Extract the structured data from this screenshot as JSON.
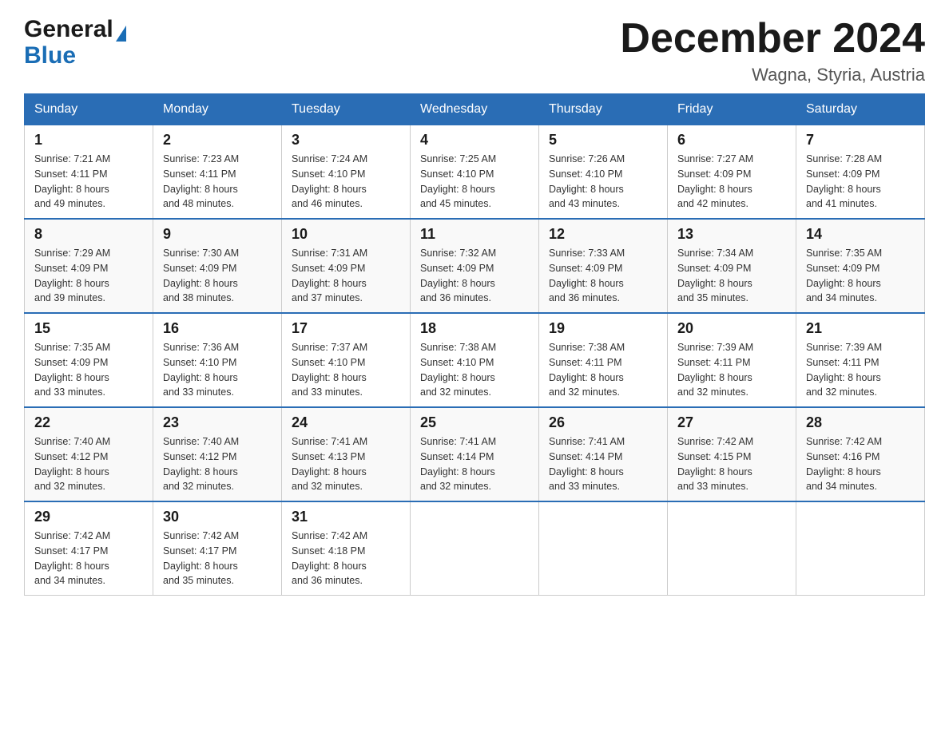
{
  "logo": {
    "general": "General",
    "blue": "Blue"
  },
  "title": "December 2024",
  "subtitle": "Wagna, Styria, Austria",
  "days_of_week": [
    "Sunday",
    "Monday",
    "Tuesday",
    "Wednesday",
    "Thursday",
    "Friday",
    "Saturday"
  ],
  "weeks": [
    [
      {
        "day": "1",
        "sunrise": "7:21 AM",
        "sunset": "4:11 PM",
        "daylight": "8 hours and 49 minutes."
      },
      {
        "day": "2",
        "sunrise": "7:23 AM",
        "sunset": "4:11 PM",
        "daylight": "8 hours and 48 minutes."
      },
      {
        "day": "3",
        "sunrise": "7:24 AM",
        "sunset": "4:10 PM",
        "daylight": "8 hours and 46 minutes."
      },
      {
        "day": "4",
        "sunrise": "7:25 AM",
        "sunset": "4:10 PM",
        "daylight": "8 hours and 45 minutes."
      },
      {
        "day": "5",
        "sunrise": "7:26 AM",
        "sunset": "4:10 PM",
        "daylight": "8 hours and 43 minutes."
      },
      {
        "day": "6",
        "sunrise": "7:27 AM",
        "sunset": "4:09 PM",
        "daylight": "8 hours and 42 minutes."
      },
      {
        "day": "7",
        "sunrise": "7:28 AM",
        "sunset": "4:09 PM",
        "daylight": "8 hours and 41 minutes."
      }
    ],
    [
      {
        "day": "8",
        "sunrise": "7:29 AM",
        "sunset": "4:09 PM",
        "daylight": "8 hours and 39 minutes."
      },
      {
        "day": "9",
        "sunrise": "7:30 AM",
        "sunset": "4:09 PM",
        "daylight": "8 hours and 38 minutes."
      },
      {
        "day": "10",
        "sunrise": "7:31 AM",
        "sunset": "4:09 PM",
        "daylight": "8 hours and 37 minutes."
      },
      {
        "day": "11",
        "sunrise": "7:32 AM",
        "sunset": "4:09 PM",
        "daylight": "8 hours and 36 minutes."
      },
      {
        "day": "12",
        "sunrise": "7:33 AM",
        "sunset": "4:09 PM",
        "daylight": "8 hours and 36 minutes."
      },
      {
        "day": "13",
        "sunrise": "7:34 AM",
        "sunset": "4:09 PM",
        "daylight": "8 hours and 35 minutes."
      },
      {
        "day": "14",
        "sunrise": "7:35 AM",
        "sunset": "4:09 PM",
        "daylight": "8 hours and 34 minutes."
      }
    ],
    [
      {
        "day": "15",
        "sunrise": "7:35 AM",
        "sunset": "4:09 PM",
        "daylight": "8 hours and 33 minutes."
      },
      {
        "day": "16",
        "sunrise": "7:36 AM",
        "sunset": "4:10 PM",
        "daylight": "8 hours and 33 minutes."
      },
      {
        "day": "17",
        "sunrise": "7:37 AM",
        "sunset": "4:10 PM",
        "daylight": "8 hours and 33 minutes."
      },
      {
        "day": "18",
        "sunrise": "7:38 AM",
        "sunset": "4:10 PM",
        "daylight": "8 hours and 32 minutes."
      },
      {
        "day": "19",
        "sunrise": "7:38 AM",
        "sunset": "4:11 PM",
        "daylight": "8 hours and 32 minutes."
      },
      {
        "day": "20",
        "sunrise": "7:39 AM",
        "sunset": "4:11 PM",
        "daylight": "8 hours and 32 minutes."
      },
      {
        "day": "21",
        "sunrise": "7:39 AM",
        "sunset": "4:11 PM",
        "daylight": "8 hours and 32 minutes."
      }
    ],
    [
      {
        "day": "22",
        "sunrise": "7:40 AM",
        "sunset": "4:12 PM",
        "daylight": "8 hours and 32 minutes."
      },
      {
        "day": "23",
        "sunrise": "7:40 AM",
        "sunset": "4:12 PM",
        "daylight": "8 hours and 32 minutes."
      },
      {
        "day": "24",
        "sunrise": "7:41 AM",
        "sunset": "4:13 PM",
        "daylight": "8 hours and 32 minutes."
      },
      {
        "day": "25",
        "sunrise": "7:41 AM",
        "sunset": "4:14 PM",
        "daylight": "8 hours and 32 minutes."
      },
      {
        "day": "26",
        "sunrise": "7:41 AM",
        "sunset": "4:14 PM",
        "daylight": "8 hours and 33 minutes."
      },
      {
        "day": "27",
        "sunrise": "7:42 AM",
        "sunset": "4:15 PM",
        "daylight": "8 hours and 33 minutes."
      },
      {
        "day": "28",
        "sunrise": "7:42 AM",
        "sunset": "4:16 PM",
        "daylight": "8 hours and 34 minutes."
      }
    ],
    [
      {
        "day": "29",
        "sunrise": "7:42 AM",
        "sunset": "4:17 PM",
        "daylight": "8 hours and 34 minutes."
      },
      {
        "day": "30",
        "sunrise": "7:42 AM",
        "sunset": "4:17 PM",
        "daylight": "8 hours and 35 minutes."
      },
      {
        "day": "31",
        "sunrise": "7:42 AM",
        "sunset": "4:18 PM",
        "daylight": "8 hours and 36 minutes."
      },
      null,
      null,
      null,
      null
    ]
  ],
  "labels": {
    "sunrise": "Sunrise: ",
    "sunset": "Sunset: ",
    "daylight": "Daylight: "
  }
}
